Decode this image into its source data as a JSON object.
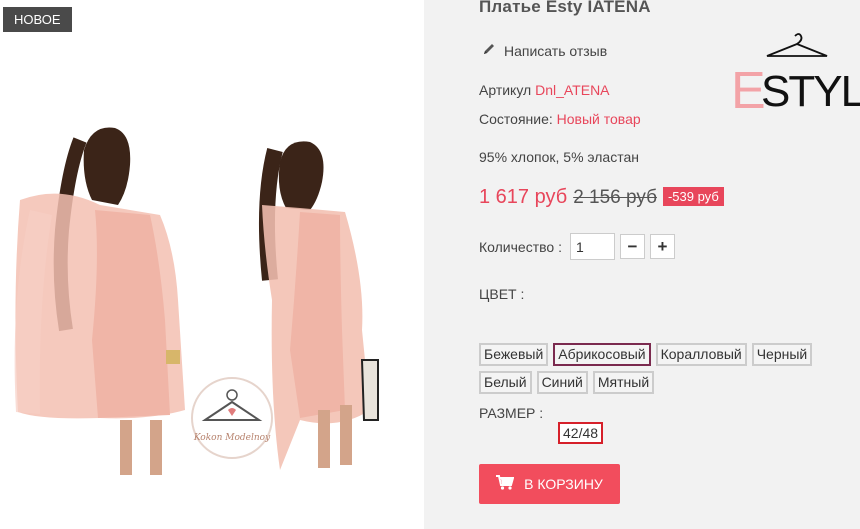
{
  "badge": {
    "label": "НОВОЕ"
  },
  "product": {
    "title": "Платье Esty IATENA",
    "review_label": "Написать отзыв",
    "sku_label": "Артикул",
    "sku_value": "Dnl_ATENA",
    "condition_label": "Состояние:",
    "condition_value": "Новый товар",
    "composition": "95% хлопок, 5% эластан"
  },
  "logo": {
    "text": "ESTYL"
  },
  "photo_watermark": {
    "text": "Kokon Modelnoy"
  },
  "price": {
    "current": "1 617 руб",
    "old": "2 156 руб",
    "discount": "-539 руб"
  },
  "quantity": {
    "label": "Количество :",
    "value": "1",
    "minus": "−",
    "plus": "+"
  },
  "color": {
    "title": "ЦВЕТ :",
    "options": [
      "Бежевый",
      "Абрикосовый",
      "Коралловый",
      "Черный",
      "Белый",
      "Синий",
      "Мятный"
    ],
    "selected": "Абрикосовый"
  },
  "size": {
    "title": "РАЗМЕР :",
    "options": [
      "42/48"
    ],
    "selected": "42/48"
  },
  "cart": {
    "label": "В КОРЗИНУ"
  },
  "colors": {
    "accent": "#e8465b",
    "button": "#f24d5d",
    "panel_bg": "#f2f2f2",
    "badge_bg": "#4a4a4a"
  }
}
